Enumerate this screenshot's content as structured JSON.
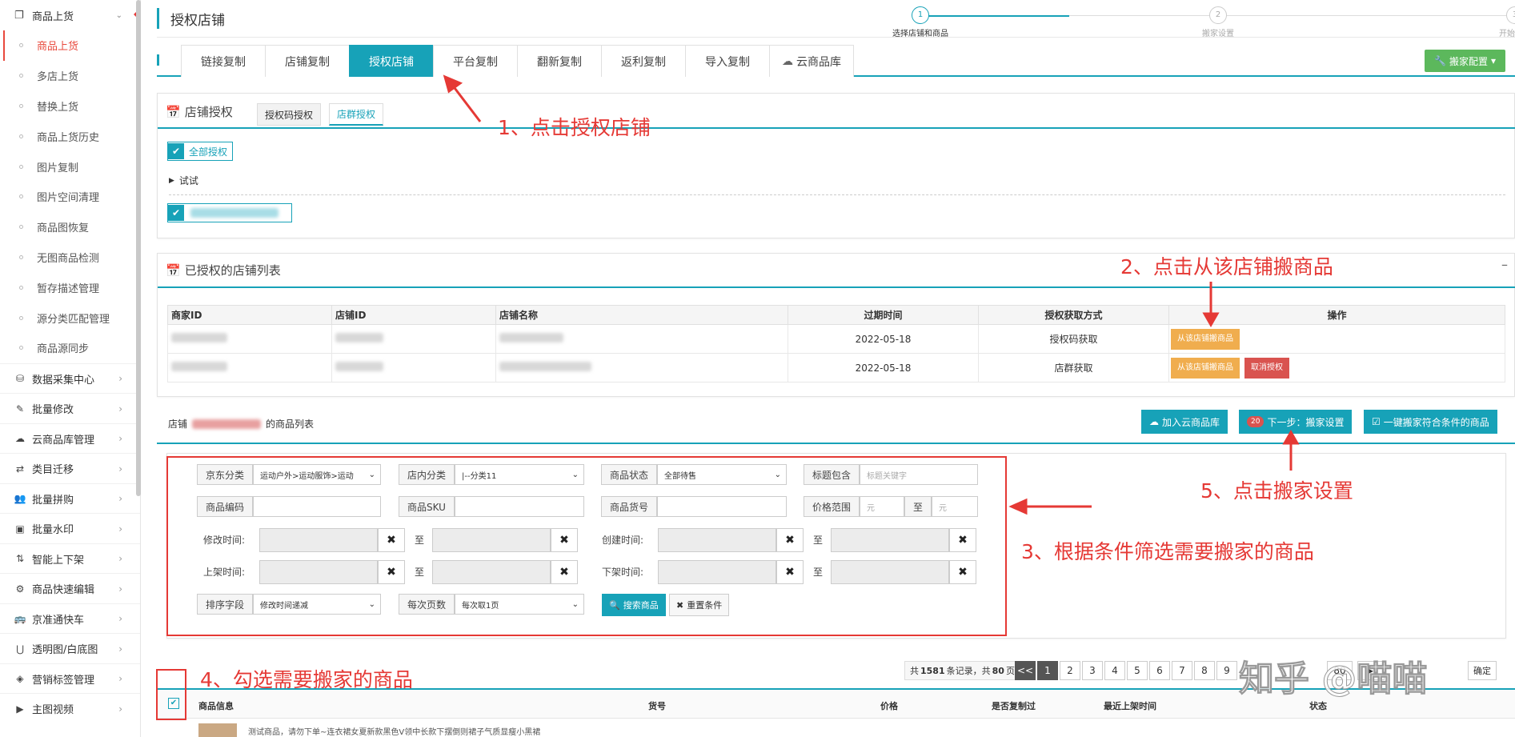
{
  "sidebar": {
    "top_item": "商品上货",
    "sub_items": [
      "商品上货",
      "多店上货",
      "替换上货",
      "商品上货历史",
      "图片复制",
      "图片空间清理",
      "商品图恢复",
      "无图商品检测",
      "暂存描述管理",
      "源分类匹配管理",
      "商品源同步"
    ],
    "groups": [
      {
        "label": "数据采集中心",
        "icon": "database-icon"
      },
      {
        "label": "批量修改",
        "icon": "edit-icon"
      },
      {
        "label": "云商品库管理",
        "icon": "cloud-icon"
      },
      {
        "label": "类目迁移",
        "icon": "exchange-icon"
      },
      {
        "label": "批量拼购",
        "icon": "users-icon"
      },
      {
        "label": "批量水印",
        "icon": "image-icon"
      },
      {
        "label": "智能上下架",
        "icon": "sort-icon"
      },
      {
        "label": "商品快速编辑",
        "icon": "gears-icon"
      },
      {
        "label": "京准通快车",
        "icon": "bus-icon"
      },
      {
        "label": "透明图/白底图",
        "icon": "magnet-icon"
      },
      {
        "label": "营销标签管理",
        "icon": "cube-icon"
      },
      {
        "label": "主图视频",
        "icon": "video-icon"
      }
    ]
  },
  "header": {
    "title": "授权店铺"
  },
  "steps": [
    {
      "num": "1",
      "label": "选择店铺和商品"
    },
    {
      "num": "2",
      "label": "搬家设置"
    },
    {
      "num": "3",
      "label": "开始搬家"
    }
  ],
  "tabs": [
    "链接复制",
    "店铺复制",
    "授权店铺",
    "平台复制",
    "翻新复制",
    "返利复制",
    "导入复制",
    "云商品库"
  ],
  "config_button": "搬家配置",
  "auth_panel": {
    "title": "店铺授权",
    "subtabs": [
      "授权码授权",
      "店群授权"
    ],
    "all_auth": "全部授权",
    "tree_node": "试试"
  },
  "store_list": {
    "title": "已授权的店铺列表",
    "collapse": "–",
    "headers": [
      "商家ID",
      "店铺ID",
      "店铺名称",
      "过期时间",
      "授权获取方式",
      "操作"
    ],
    "rows": [
      {
        "expire": "2022-05-18",
        "method": "授权码获取",
        "btn1": "从该店铺搬商品"
      },
      {
        "expire": "2022-05-18",
        "method": "店群获取",
        "btn1": "从该店铺搬商品",
        "btn2": "取消授权"
      }
    ]
  },
  "goods_list": {
    "prefix": "店铺",
    "suffix": "的商品列表",
    "btn_cloud": "加入云商品库",
    "next_badge": "20",
    "btn_next": "下一步：搬家设置",
    "btn_onekey": "一键搬家符合条件的商品"
  },
  "filters": {
    "jd_cat_label": "京东分类",
    "jd_cat_value": "运动户外>运动服饰>运动",
    "store_cat_label": "店内分类",
    "store_cat_value": "|--分类11",
    "status_label": "商品状态",
    "status_value": "全部待售",
    "title_label": "标题包含",
    "title_placeholder": "标题关键字",
    "code_label": "商品编码",
    "sku_label": "商品SKU",
    "huohao_label": "商品货号",
    "price_label": "价格范围",
    "price_unit": "元",
    "to": "至",
    "mod_time": "修改时间:",
    "create_time": "创建时间:",
    "up_time": "上架时间:",
    "down_time": "下架时间:",
    "sort_label": "排序字段",
    "sort_value": "修改时间递减",
    "per_label": "每次页数",
    "per_value": "每次取1页",
    "search_btn": "搜索商品",
    "reset_btn": "重置条件"
  },
  "pagination": {
    "summary_pre": "共",
    "total": "1581",
    "summary_mid": "条记录，共",
    "pages": "80",
    "summary_post": "页",
    "prev": "<<",
    "page_nums": [
      "1",
      "2",
      "3",
      "4",
      "5",
      "6",
      "7",
      "8",
      "9"
    ],
    "last_page": "80",
    "ok": "确定"
  },
  "product_table": {
    "headers": [
      "商品信息",
      "货号",
      "价格",
      "是否复制过",
      "最近上架时间",
      "状态"
    ],
    "first_row_title": "测试商品，请勿下单~连衣裙女夏新款黑色V领中长款下摆倒则裙子气质显瘦小黑裙"
  },
  "annotations": {
    "a1": "1、点击授权店铺",
    "a2": "2、点击从该店铺搬商品",
    "a3": "3、根据条件筛选需要搬家的商品",
    "a4": "4、勾选需要搬家的商品",
    "a5": "5、点击搬家设置",
    "watermark": "知乎 @喵喵"
  },
  "colors": {
    "accent": "#17a2b8",
    "annotation": "#e53935",
    "sidebar_active": "#e8493d",
    "green": "#5cb85c",
    "orange": "#f0ad4e",
    "red": "#d9534f"
  }
}
